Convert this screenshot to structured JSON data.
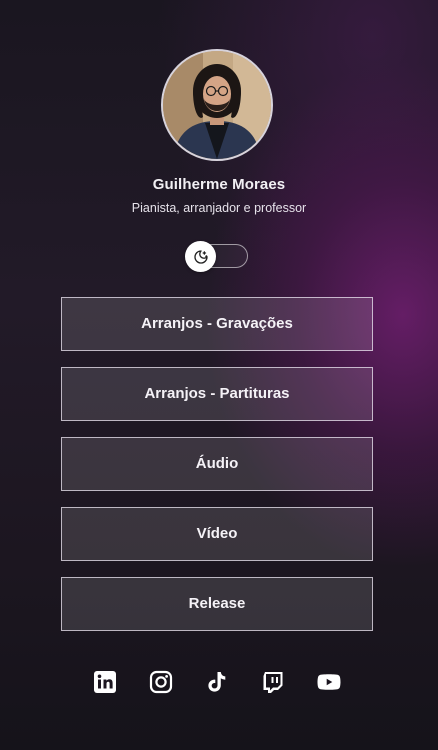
{
  "profile": {
    "name": "Guilherme Moraes",
    "bio": "Pianista, arranjador e professor"
  },
  "theme_toggle": {
    "icon": "moon-sun-icon",
    "state": "dark"
  },
  "links": [
    {
      "label": "Arranjos - Gravações"
    },
    {
      "label": "Arranjos - Partituras"
    },
    {
      "label": "Áudio"
    },
    {
      "label": "Vídeo"
    },
    {
      "label": "Release"
    }
  ],
  "social": [
    {
      "icon": "linkedin-icon"
    },
    {
      "icon": "instagram-icon"
    },
    {
      "icon": "tiktok-icon"
    },
    {
      "icon": "twitch-icon"
    },
    {
      "icon": "youtube-icon"
    }
  ],
  "colors": {
    "background_dark": "#1a1620",
    "background_accent": "#701e70",
    "button_border": "#ebe4f0",
    "text": "#ffffff"
  }
}
